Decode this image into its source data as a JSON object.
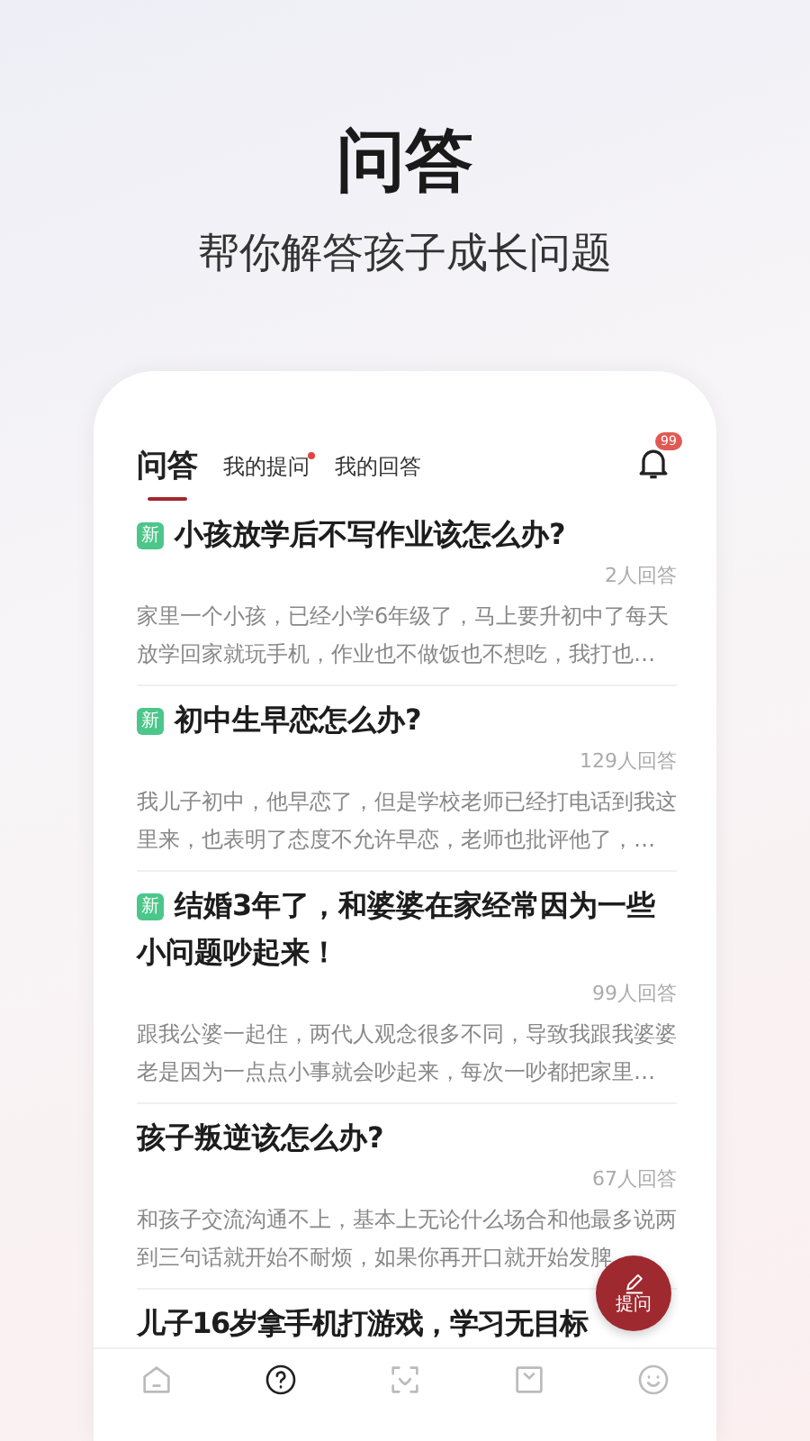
{
  "hero": {
    "title": "问答",
    "subtitle": "帮你解答孩子成长问题"
  },
  "tabs": [
    {
      "label": "问答",
      "selected": true,
      "dot": false
    },
    {
      "label": "我的提问",
      "selected": false,
      "dot": true
    },
    {
      "label": "我的回答",
      "selected": false,
      "dot": false
    }
  ],
  "notifications": {
    "badge": "99"
  },
  "questions": [
    {
      "new_tag": "新",
      "title": "小孩放学后不写作业该怎么办?",
      "answers": "2人回答",
      "excerpt": "家里一个小孩，已经小学6年级了，马上要升初中了每天放学回家就玩手机，作业也不做饭也不想吃，我打也…"
    },
    {
      "new_tag": "新",
      "title": "初中生早恋怎么办?",
      "answers": "129人回答",
      "excerpt": "我儿子初中，他早恋了，但是学校老师已经打电话到我这里来，也表明了态度不允许早恋，老师也批评他了，…"
    },
    {
      "new_tag": "新",
      "title": "结婚3年了，和婆婆在家经常因为一些小问题吵起来！",
      "answers": "99人回答",
      "excerpt": "跟我公婆一起住，两代人观念很多不同，导致我跟我婆婆老是因为一点点小事就会吵起来，每次一吵都把家里…"
    },
    {
      "title": "孩子叛逆该怎么办?",
      "answers": "67人回答",
      "excerpt": "和孩子交流沟通不上，基本上无论什么场合和他最多说两到三句话就开始不耐烦，如果你再开口就开始发脾"
    },
    {
      "title": "儿子16岁拿手机打游戏，学习无目标"
    }
  ],
  "fab": {
    "label": "提问"
  },
  "bottom_nav": [
    {
      "kind": "home",
      "selected": false
    },
    {
      "kind": "question",
      "selected": true
    },
    {
      "kind": "scan",
      "selected": false
    },
    {
      "kind": "bag",
      "selected": false
    },
    {
      "kind": "smile",
      "selected": false
    }
  ]
}
